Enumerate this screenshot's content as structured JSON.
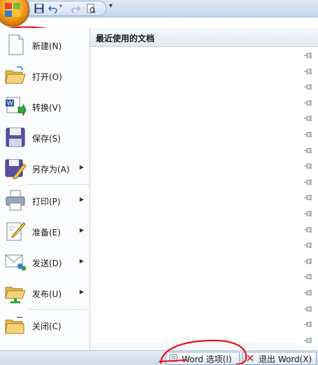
{
  "menu": {
    "items": [
      {
        "label": "新建(N)",
        "icon": "new-document-icon",
        "has_submenu": false
      },
      {
        "label": "打开(O)",
        "icon": "open-folder-icon",
        "has_submenu": false
      },
      {
        "label": "转换(V)",
        "icon": "convert-icon",
        "has_submenu": false
      },
      {
        "label": "保存(S)",
        "icon": "save-icon",
        "has_submenu": false
      },
      {
        "label": "另存为(A)",
        "icon": "save-as-icon",
        "has_submenu": true
      },
      {
        "label": "打印(P)",
        "icon": "printer-icon",
        "has_submenu": true
      },
      {
        "label": "准备(E)",
        "icon": "prepare-icon",
        "has_submenu": true
      },
      {
        "label": "发送(D)",
        "icon": "send-icon",
        "has_submenu": true
      },
      {
        "label": "发布(U)",
        "icon": "publish-icon",
        "has_submenu": true
      },
      {
        "label": "关闭(C)",
        "icon": "close-folder-icon",
        "has_submenu": false
      }
    ],
    "submenu_arrow": "▶"
  },
  "recent": {
    "title": "最近使用的文档",
    "pin_count": 19
  },
  "bottom": {
    "options_label": "Word 选项(I)",
    "exit_label": "退出 Word(X)"
  },
  "qat": {
    "more_glyph": "▾"
  },
  "colors": {
    "annotation": "#e8101a",
    "accent": "#f7a11a"
  }
}
